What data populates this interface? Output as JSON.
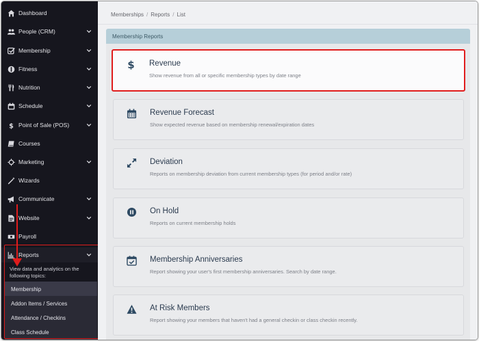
{
  "sidebar": {
    "items": [
      {
        "label": "Dashboard",
        "icon": "home-icon",
        "chevron": false
      },
      {
        "label": "People (CRM)",
        "icon": "users-icon",
        "chevron": true
      },
      {
        "label": "Membership",
        "icon": "check-square-icon",
        "chevron": true
      },
      {
        "label": "Fitness",
        "icon": "fitness-icon",
        "chevron": true
      },
      {
        "label": "Nutrition",
        "icon": "utensils-icon",
        "chevron": true
      },
      {
        "label": "Schedule",
        "icon": "calendar-icon",
        "chevron": true
      },
      {
        "label": "Point of Sale (POS)",
        "icon": "dollar-icon",
        "chevron": true
      },
      {
        "label": "Courses",
        "icon": "book-icon",
        "chevron": false
      },
      {
        "label": "Marketing",
        "icon": "crosshair-icon",
        "chevron": true
      },
      {
        "label": "Wizards",
        "icon": "magic-wand-icon",
        "chevron": false
      },
      {
        "label": "Communicate",
        "icon": "megaphone-icon",
        "chevron": true
      },
      {
        "label": "Website",
        "icon": "file-icon",
        "chevron": true
      },
      {
        "label": "Payroll",
        "icon": "money-icon",
        "chevron": false
      }
    ],
    "reports": {
      "label": "Reports",
      "icon": "bar-chart-icon",
      "description": "View data and analytics on the following topics:",
      "submenu": [
        "Membership",
        "Addon Items / Services",
        "Attendance / Checkins",
        "Class Schedule"
      ],
      "active_submenu": "Membership"
    }
  },
  "breadcrumb": [
    "Memberships",
    "Reports",
    "List"
  ],
  "panel": {
    "title": "Membership Reports",
    "cards": [
      {
        "title": "Revenue",
        "description": "Show revenue from all or specific membership types by date range",
        "icon": "dollar-icon",
        "highlighted": true
      },
      {
        "title": "Revenue Forecast",
        "description": "Show expected revenue based on membership renewal/expiration dates",
        "icon": "calendar-grid-icon",
        "highlighted": false
      },
      {
        "title": "Deviation",
        "description": "Reports on membership deviation from current membership types (for period and/or rate)",
        "icon": "expand-arrows-icon",
        "highlighted": false
      },
      {
        "title": "On Hold",
        "description": "Reports on current membership holds",
        "icon": "pause-circle-icon",
        "highlighted": false
      },
      {
        "title": "Membership Anniversaries",
        "description": "Report showing your user's first membership anniversaries. Search by date range.",
        "icon": "calendar-check-icon",
        "highlighted": false
      },
      {
        "title": "At Risk Members",
        "description": "Report showing your members that haven't had a general checkin or class checkin recently.",
        "icon": "warning-icon",
        "highlighted": false
      }
    ]
  },
  "colors": {
    "sidebar_bg": "#16161e",
    "panel_header": "#b6cfd9",
    "annotation_red": "#e01c1c",
    "card_icon": "#2e4a63"
  }
}
